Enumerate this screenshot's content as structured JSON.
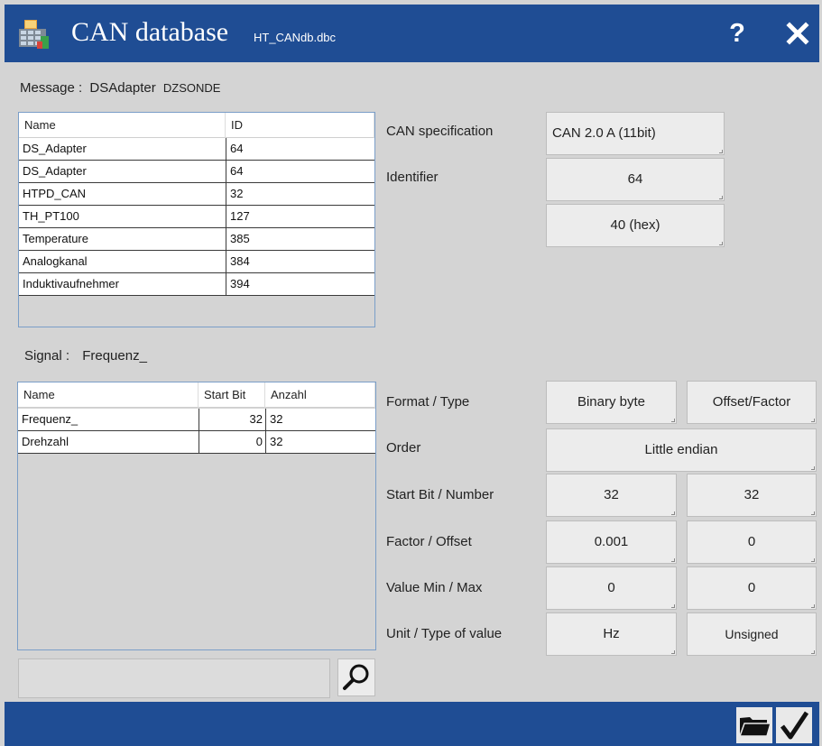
{
  "window": {
    "title": "CAN database",
    "file": "HT_CANdb.dbc"
  },
  "message": {
    "label": "Message :",
    "name": "DSAdapter",
    "sub": "DZSONDE",
    "columns": [
      "Name",
      "ID"
    ],
    "rows": [
      [
        "DS_Adapter",
        "64"
      ],
      [
        "DS_Adapter",
        "64"
      ],
      [
        "HTPD_CAN",
        "32"
      ],
      [
        "TH_PT100",
        "127"
      ],
      [
        "Temperature",
        "385"
      ],
      [
        "Analogkanal",
        "384"
      ],
      [
        "Induktivaufnehmer",
        "394"
      ]
    ]
  },
  "signal": {
    "label": "Signal :",
    "name": "Frequenz_",
    "columns": [
      "Name",
      "Start Bit",
      "Anzahl"
    ],
    "rows": [
      [
        "Frequenz_",
        "32",
        "32"
      ],
      [
        "Drehzahl",
        "0",
        "32"
      ]
    ]
  },
  "can_props": {
    "spec_label": "CAN specification",
    "spec_value": "CAN 2.0 A (11bit)",
    "identifier_label": "Identifier",
    "identifier_dec": "64",
    "identifier_hex": "40 (hex)"
  },
  "signal_props": {
    "format_label": "Format / Type",
    "format_value": "Binary byte",
    "type_value": "Offset/Factor",
    "order_label": "Order",
    "order_value": "Little endian",
    "startbit_label": "Start Bit / Number",
    "startbit_value": "32",
    "number_value": "32",
    "factor_label": "Factor / Offset",
    "factor_value": "0.001",
    "offset_value": "0",
    "minmax_label": "Value Min / Max",
    "min_value": "0",
    "max_value": "0",
    "unit_label": "Unit / Type of value",
    "unit_value": "Hz",
    "valuetype_value": "Unsigned"
  },
  "search": {
    "value": ""
  },
  "icons": {
    "app": "database-table-icon",
    "help": "question-mark-icon",
    "close": "close-icon",
    "search": "magnifier-icon",
    "open": "folder-open-icon",
    "confirm": "checkmark-icon"
  },
  "colors": {
    "titlebar": "#1f4d94",
    "background": "#d4d4d4",
    "table_border": "#7a9ec8"
  }
}
